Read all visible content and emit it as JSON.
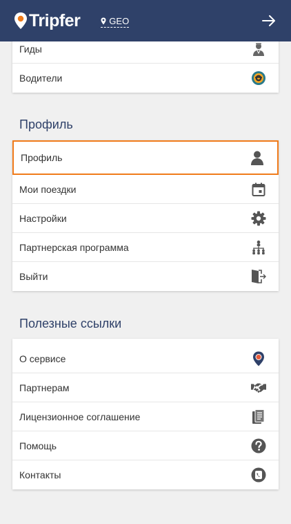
{
  "header": {
    "logo_text": "Tripfer",
    "geo_label": "GEO"
  },
  "top_card": {
    "items": [
      {
        "label": "Гиды",
        "icon": "guide-icon"
      },
      {
        "label": "Водители",
        "icon": "steering-wheel-icon"
      }
    ]
  },
  "profile_section": {
    "title": "Профиль",
    "items": [
      {
        "label": "Профиль",
        "icon": "user-icon"
      },
      {
        "label": "Мои поездки",
        "icon": "calendar-icon"
      },
      {
        "label": "Настройки",
        "icon": "gear-icon"
      },
      {
        "label": "Партнерская программа",
        "icon": "hierarchy-icon"
      },
      {
        "label": "Выйти",
        "icon": "logout-icon"
      }
    ]
  },
  "links_section": {
    "title": "Полезные ссылки",
    "items": [
      {
        "label": "О сервисе",
        "icon": "location-pin-icon"
      },
      {
        "label": "Партнерам",
        "icon": "handshake-icon"
      },
      {
        "label": "Лицензионное соглашение",
        "icon": "document-icon"
      },
      {
        "label": "Помощь",
        "icon": "help-icon"
      },
      {
        "label": "Контакты",
        "icon": "phone-icon"
      }
    ]
  },
  "colors": {
    "header_bg": "#2f4169",
    "accent_orange": "#f07b1a",
    "icon_dark": "#555555",
    "section_title": "#2f4169"
  }
}
